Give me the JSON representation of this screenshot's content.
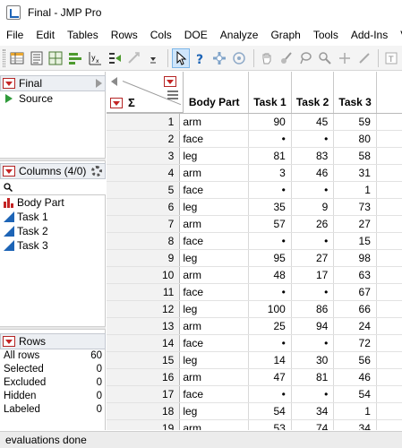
{
  "window": {
    "title": "Final - JMP Pro"
  },
  "menubar": [
    "File",
    "Edit",
    "Tables",
    "Rows",
    "Cols",
    "DOE",
    "Analyze",
    "Graph",
    "Tools",
    "Add-Ins",
    "Vie"
  ],
  "panels": {
    "table": {
      "name": "Final",
      "source": "Source"
    },
    "columns": {
      "header": "Columns (4/0)",
      "items": [
        {
          "name": "Body Part",
          "type": "nominal"
        },
        {
          "name": "Task 1",
          "type": "continuous"
        },
        {
          "name": "Task 2",
          "type": "continuous"
        },
        {
          "name": "Task 3",
          "type": "continuous"
        }
      ]
    },
    "rows": {
      "header": "Rows",
      "stats": [
        {
          "label": "All rows",
          "value": "60"
        },
        {
          "label": "Selected",
          "value": "0"
        },
        {
          "label": "Excluded",
          "value": "0"
        },
        {
          "label": "Hidden",
          "value": "0"
        },
        {
          "label": "Labeled",
          "value": "0"
        }
      ]
    }
  },
  "grid": {
    "corner_symbol": "Σ",
    "columns": [
      "Body Part",
      "Task 1",
      "Task 2",
      "Task 3"
    ],
    "rows": [
      [
        "1",
        "arm",
        "90",
        "45",
        "59"
      ],
      [
        "2",
        "face",
        "•",
        "•",
        "80"
      ],
      [
        "3",
        "leg",
        "81",
        "83",
        "58"
      ],
      [
        "4",
        "arm",
        "3",
        "46",
        "31"
      ],
      [
        "5",
        "face",
        "•",
        "•",
        "1"
      ],
      [
        "6",
        "leg",
        "35",
        "9",
        "73"
      ],
      [
        "7",
        "arm",
        "57",
        "26",
        "27"
      ],
      [
        "8",
        "face",
        "•",
        "•",
        "15"
      ],
      [
        "9",
        "leg",
        "95",
        "27",
        "98"
      ],
      [
        "10",
        "arm",
        "48",
        "17",
        "63"
      ],
      [
        "11",
        "face",
        "•",
        "•",
        "67"
      ],
      [
        "12",
        "leg",
        "100",
        "86",
        "66"
      ],
      [
        "13",
        "arm",
        "25",
        "94",
        "24"
      ],
      [
        "14",
        "face",
        "•",
        "•",
        "72"
      ],
      [
        "15",
        "leg",
        "14",
        "30",
        "56"
      ],
      [
        "16",
        "arm",
        "47",
        "81",
        "46"
      ],
      [
        "17",
        "face",
        "•",
        "•",
        "54"
      ],
      [
        "18",
        "leg",
        "54",
        "34",
        "1"
      ],
      [
        "19",
        "arm",
        "53",
        "74",
        "34"
      ]
    ]
  },
  "status": {
    "text": "evaluations done"
  },
  "colors": {
    "accent_red": "#c42525",
    "source_green": "#2f9a3a",
    "continuous_blue": "#1d64b6",
    "nominal_red": "#c42525"
  }
}
